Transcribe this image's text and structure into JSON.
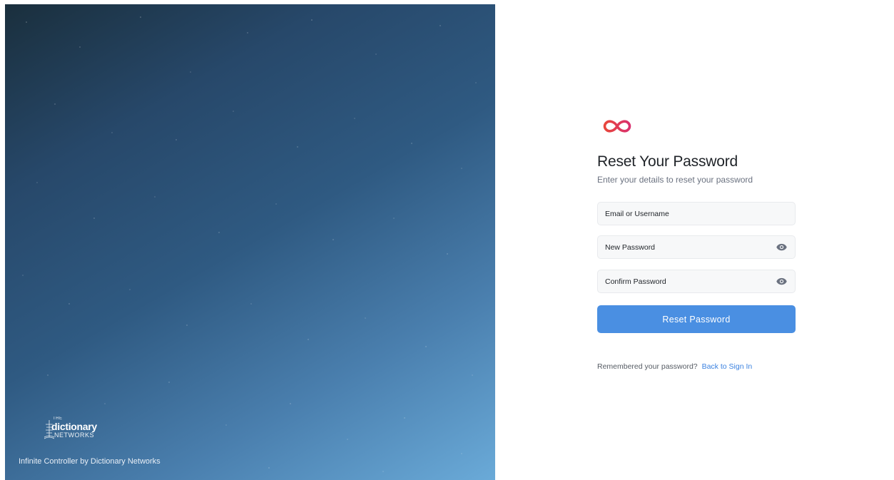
{
  "hero": {
    "logo_small": "THE",
    "logo_main": "dictionary",
    "logo_sub": "NETWORKS",
    "footer": "Infinite Controller by Dictionary Networks"
  },
  "brand": {
    "icon": "infinity-icon",
    "accent_start": "#e8463b",
    "accent_end": "#d9306e"
  },
  "form": {
    "title": "Reset Your Password",
    "subtitle": "Enter your details to reset your password",
    "email_placeholder": "Email or Username",
    "new_password_placeholder": "New Password",
    "confirm_password_placeholder": "Confirm Password",
    "show_password_icon": "eye-icon",
    "submit_label": "Reset Password",
    "submit_color": "#4a8fe2"
  },
  "footer": {
    "remember_text": "Remembered your password?",
    "back_link": "Back to Sign In"
  }
}
